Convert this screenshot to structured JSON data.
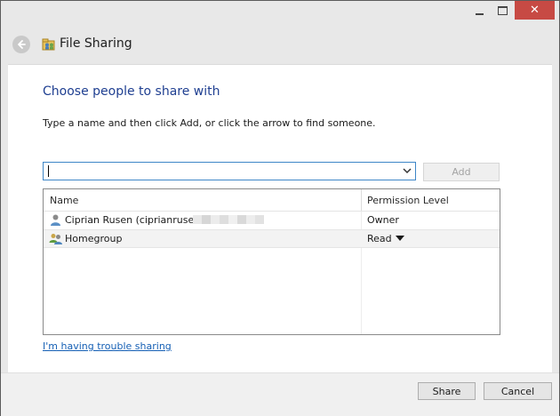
{
  "window": {
    "title": "File Sharing",
    "close_glyph": "✕",
    "icons": {
      "back": "back-arrow-icon",
      "title": "sharing-wizard-icon",
      "minimize": "minimize-icon",
      "maximize": "maximize-icon",
      "close": "close-icon"
    }
  },
  "content": {
    "heading": "Choose people to share with",
    "instruction": "Type a name and then click Add, or click the arrow to find someone.",
    "name_input": {
      "value": "",
      "placeholder": ""
    },
    "add_label": "Add",
    "list": {
      "columns": [
        "Name",
        "Permission Level"
      ],
      "rows": [
        {
          "name": "Ciprian Rusen (ciprianrusen",
          "permission": "Owner",
          "icon": "user-icon"
        },
        {
          "name": "Homegroup",
          "permission": "Read",
          "icon": "homegroup-icon"
        }
      ]
    },
    "trouble_link": "I'm having trouble sharing"
  },
  "footer": {
    "share_label": "Share",
    "cancel_label": "Cancel"
  },
  "colors": {
    "heading": "#1f3f91",
    "link": "#1660b5",
    "close_button": "#c74a44",
    "focus_border": "#3e86c7"
  }
}
